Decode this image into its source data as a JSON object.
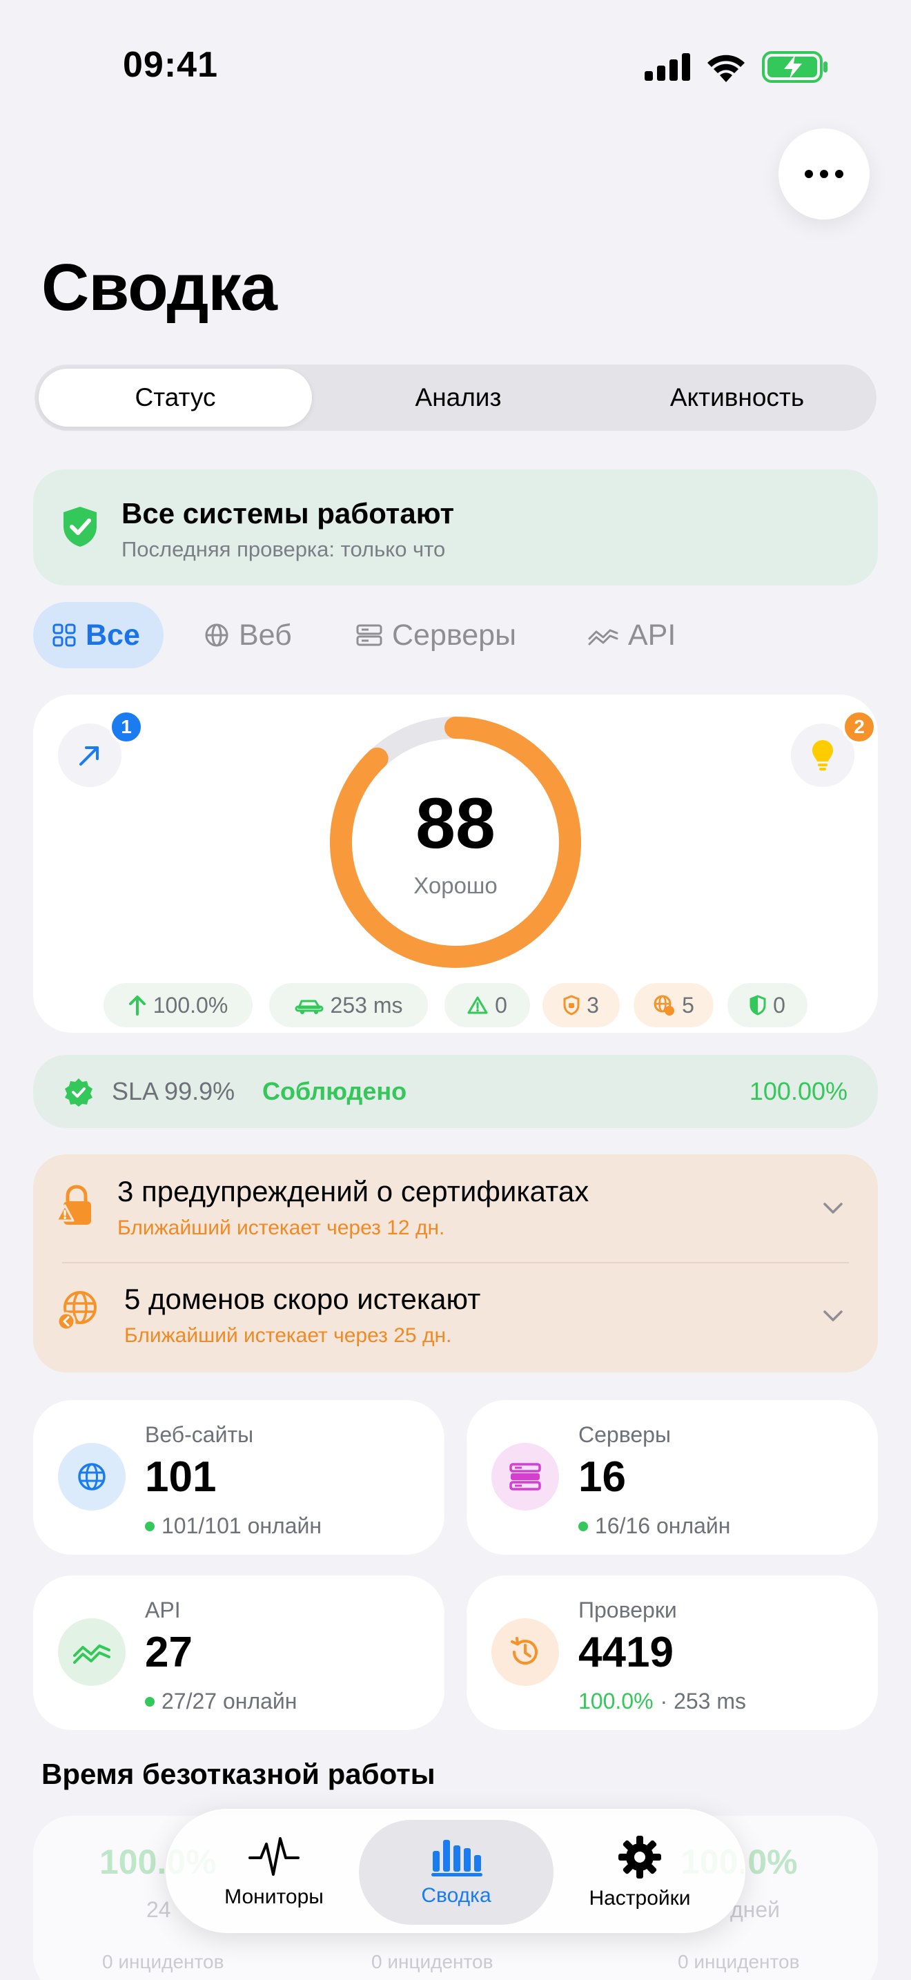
{
  "status_bar": {
    "time": "09:41"
  },
  "page": {
    "title": "Сводка"
  },
  "segments": [
    "Статус",
    "Анализ",
    "Активность"
  ],
  "banner": {
    "title": "Все системы работают",
    "subtitle": "Последняя проверка: только что"
  },
  "filters": [
    "Все",
    "Веб",
    "Серверы",
    "API"
  ],
  "score": {
    "value": "88",
    "label": "Хорошо",
    "ring_fraction": 0.88,
    "left_badge": "1",
    "right_badge": "2",
    "pills": {
      "uptime": "100.0%",
      "latency": "253 ms",
      "alerts": "0",
      "certs": "3",
      "domains": "5",
      "security": "0"
    }
  },
  "sla": {
    "label": "SLA 99.9%",
    "status": "Соблюдено",
    "value": "100.00%"
  },
  "warnings": [
    {
      "title": "3 предупреждений о сертификатах",
      "subtitle": "Ближайший истекает через 12 дн."
    },
    {
      "title": "5 доменов скоро истекают",
      "subtitle": "Ближайший истекает через 25 дн."
    }
  ],
  "stats": {
    "websites": {
      "label": "Веб-сайты",
      "value": "101",
      "sub": "101/101 онлайн"
    },
    "servers": {
      "label": "Серверы",
      "value": "16",
      "sub": "16/16 онлайн"
    },
    "api": {
      "label": "API",
      "value": "27",
      "sub": "27/27 онлайн"
    },
    "checks": {
      "label": "Проверки",
      "value": "4419",
      "sub_pct": "100.0%",
      "sub_rest": "· 253 ms"
    }
  },
  "uptime_section": {
    "title": "Время безотказной работы"
  },
  "uptime_ghost": {
    "a": "100.0%",
    "a_period": "24",
    "a_inc": "0 инцидентов",
    "b_inc": "0 инцидентов",
    "c": "100.0%",
    "c_period": "дней",
    "c_inc": "0 инцидентов"
  },
  "tabbar": [
    {
      "label": "Мониторы"
    },
    {
      "label": "Сводка"
    },
    {
      "label": "Настройки"
    }
  ],
  "colors": {
    "accent": "#1a7cf0",
    "ok": "#34c759",
    "warn": "#f5922a",
    "ring_track": "#e5e5ea"
  }
}
